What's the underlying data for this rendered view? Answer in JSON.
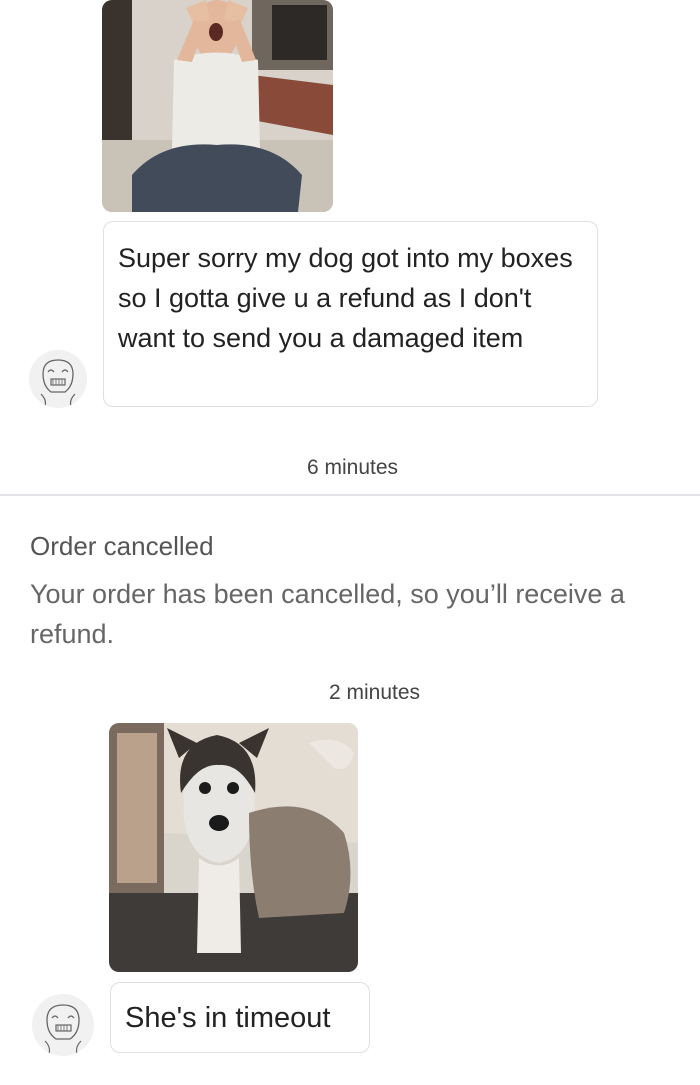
{
  "messages": [
    {
      "type": "image",
      "image": "person-kneeling-screaming-photo"
    },
    {
      "type": "text",
      "avatar": "cartoon-face-avatar",
      "text": "Super sorry my dog got into my boxes so I gotta give u a refund as I don't want to send you a damaged item"
    },
    {
      "type": "timestamp",
      "text": "6 minutes"
    },
    {
      "type": "system",
      "title": "Order cancelled",
      "body": "Your order has been cancelled, so you’ll receive a refund."
    },
    {
      "type": "timestamp",
      "text": "2 minutes"
    },
    {
      "type": "image",
      "image": "husky-dog-photo"
    },
    {
      "type": "text",
      "avatar": "cartoon-face-avatar",
      "text": "She's in timeout"
    }
  ],
  "colors": {
    "background": "#f4f5f6",
    "panel": "#ffffff",
    "bubble_border": "#dcdfe3",
    "text": "#222222",
    "muted_text": "#666666"
  }
}
